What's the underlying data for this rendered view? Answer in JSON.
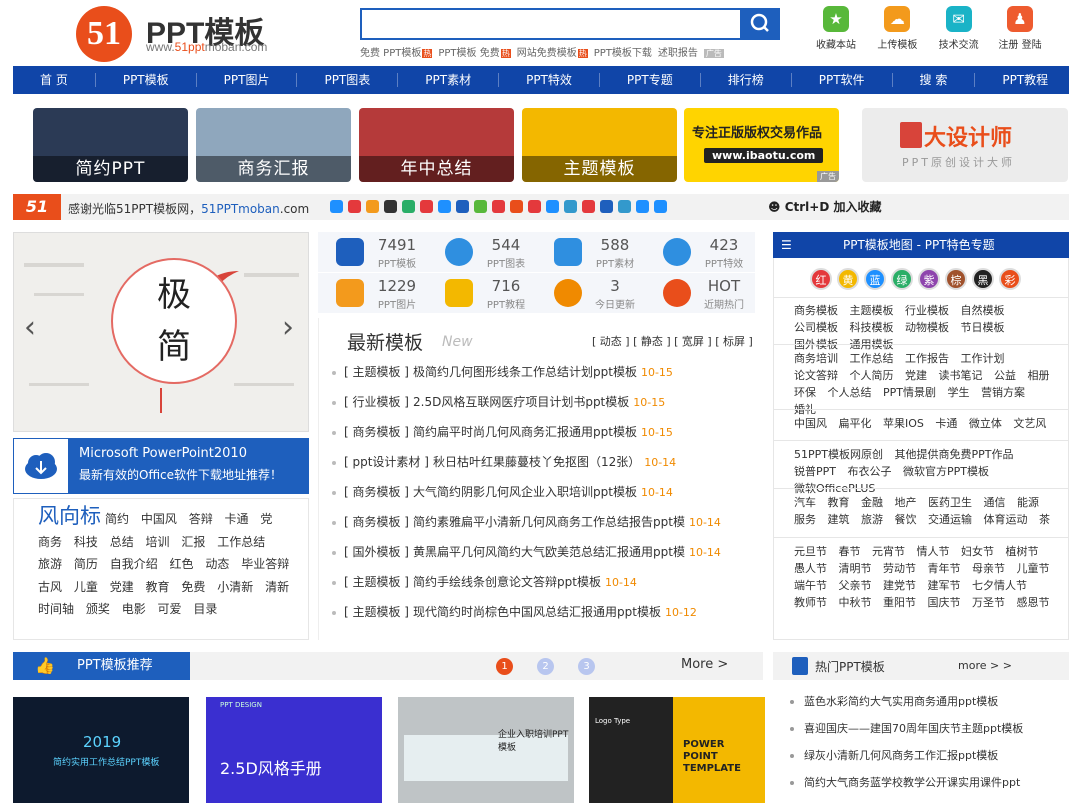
{
  "header": {
    "logo_mark": "51",
    "logo_title": "PPT模板",
    "logo_url_prefix": "www.",
    "logo_url_brand": "51ppt",
    "logo_url_suffix": "moban.com",
    "search_placeholder": "",
    "hot_links": [
      {
        "text": "免费 PPT模板",
        "badge": "热"
      },
      {
        "text": "PPT模板 免费",
        "badge": "热"
      },
      {
        "text": "网站免费模板",
        "badge": "热"
      },
      {
        "text": "PPT模板下载",
        "badge": ""
      },
      {
        "text": "述职报告",
        "badge": ""
      }
    ],
    "ad_label": "广告",
    "quick_links": [
      {
        "label": "收藏本站",
        "icon": "star-icon",
        "glyph": "★",
        "color": "#58b83a"
      },
      {
        "label": "上传模板",
        "icon": "upload-cloud-icon",
        "glyph": "☁",
        "color": "#f39a1c"
      },
      {
        "label": "技术交流",
        "icon": "chat-icon",
        "glyph": "✉",
        "color": "#1ab3c7"
      },
      {
        "label": "注册 登陆",
        "icon": "user-icon",
        "glyph": "♟",
        "color": "#ee5b2f"
      }
    ]
  },
  "nav": [
    "首 页",
    "PPT模板",
    "PPT图片",
    "PPT图表",
    "PPT素材",
    "PPT特效",
    "PPT专题",
    "排行榜",
    "PPT软件",
    "搜 索",
    "PPT教程"
  ],
  "banners": [
    {
      "caption": "简约PPT",
      "color": "#2b3a55"
    },
    {
      "caption": "商务汇报",
      "color": "#8fa7bd"
    },
    {
      "caption": "年中总结",
      "color": "#b53a3a"
    },
    {
      "caption": "主题模板",
      "color": "#f3b800"
    },
    {
      "caption": "",
      "color": "#ffd400",
      "line1": "专注正版版权交易作品",
      "line2": "www.ibaotu.com",
      "ad": "广告"
    },
    {
      "caption": "",
      "color": "#ececec",
      "line1": "大设计师",
      "line2": "PPT原创设计大师"
    }
  ],
  "welcome": {
    "logo": "51",
    "text_prefix": "感谢光临51PPT模板网，",
    "text_brand": "51PPTmoban",
    "text_suffix": ".com",
    "shortcut": "Ctrl+D 加入收藏",
    "social_colors": [
      "#1e90ff",
      "#e4393c",
      "#f39a1c",
      "#333333",
      "#2aae67",
      "#e4393c",
      "#1e90ff",
      "#1e5fbd",
      "#58b83a",
      "#e4393c",
      "#e94e1b",
      "#e4393c",
      "#1e90ff",
      "#3399cc",
      "#e4393c",
      "#1e5fbd",
      "#3399cc",
      "#1e90ff",
      "#1e90ff"
    ]
  },
  "slide": {
    "char1": "极",
    "char2": "简",
    "prev": "‹",
    "next": "›"
  },
  "office": {
    "title": "Microsoft PowerPoint2010",
    "subtitle": "最新有效的Office软件下载地址推荐！"
  },
  "tags": {
    "heading": "风向标",
    "items": [
      "简约",
      "中国风",
      "答辩",
      "卡通",
      "党",
      "商务",
      "科技",
      "总结",
      "培训",
      "汇报",
      "工作总结",
      "旅游",
      "简历",
      "自我介绍",
      "红色",
      "动态",
      "毕业答辩",
      "古风",
      "儿童",
      "党建",
      "教育",
      "免费",
      "小清新",
      "清新",
      "时间轴",
      "颁奖",
      "电影",
      "可爱",
      "目录"
    ]
  },
  "stats": [
    {
      "num": "7491",
      "label": "PPT模板",
      "icon": "ppt-icon",
      "color": "#1e5fbd"
    },
    {
      "num": "544",
      "label": "PPT图表",
      "icon": "pie-chart-icon",
      "color": "#2f8fe0"
    },
    {
      "num": "588",
      "label": "PPT素材",
      "icon": "link-icon",
      "color": "#2f8fe0"
    },
    {
      "num": "423",
      "label": "PPT特效",
      "icon": "spinner-icon",
      "color": "#2f8fe0"
    },
    {
      "num": "1229",
      "label": "PPT图片",
      "icon": "image-icon",
      "color": "#f39a1c"
    },
    {
      "num": "716",
      "label": "PPT教程",
      "icon": "book-icon",
      "color": "#f3b800"
    },
    {
      "num": "3",
      "label": "今日更新",
      "icon": "refresh-icon",
      "color": "#f08a00"
    },
    {
      "num": "HOT",
      "label": "近期热门",
      "icon": "hot-icon",
      "color": "#e94e1b"
    }
  ],
  "latest": {
    "title": "最新模板",
    "new_label": "New",
    "filters": "[ 动态 ] [ 静态 ] [ 宽屏 ] [ 标屏 ]",
    "items": [
      {
        "cat": "[ 主题模板 ]",
        "title": "极简约几何图形线条工作总结计划ppt模板",
        "date": "10-15"
      },
      {
        "cat": "[ 行业模板 ]",
        "title": "2.5D风格互联网医疗项目计划书ppt模板",
        "date": "10-15"
      },
      {
        "cat": "[ 商务模板 ]",
        "title": "简约扁平时尚几何风商务汇报通用ppt模板",
        "date": "10-15"
      },
      {
        "cat": "[ ppt设计素材 ]",
        "title": "秋日枯叶红果藤蔓枝丫免抠图（12张）",
        "date": "10-14"
      },
      {
        "cat": "[ 商务模板 ]",
        "title": "大气简约阴影几何风企业入职培训ppt模板",
        "date": "10-14"
      },
      {
        "cat": "[ 商务模板 ]",
        "title": "简约素雅扁平小清新几何风商务工作总结报告ppt模",
        "date": "10-14"
      },
      {
        "cat": "[ 国外模板 ]",
        "title": "黄黑扁平几何风简约大气欧美范总结汇报通用ppt模",
        "date": "10-14"
      },
      {
        "cat": "[ 主题模板 ]",
        "title": "简约手绘线条创意论文答辩ppt模板",
        "date": "10-14"
      },
      {
        "cat": "[ 主题模板 ]",
        "title": "现代简约时尚棕色中国风总结汇报通用ppt模板",
        "date": "10-12"
      }
    ]
  },
  "map": {
    "title": "PPT模板地图 - PPT特色专题",
    "colors": [
      {
        "label": "红",
        "color": "#e4393c"
      },
      {
        "label": "黄",
        "color": "#f3b800"
      },
      {
        "label": "蓝",
        "color": "#1e90ff"
      },
      {
        "label": "绿",
        "color": "#2aae67"
      },
      {
        "label": "紫",
        "color": "#8e44ad"
      },
      {
        "label": "棕",
        "color": "#a0522d"
      },
      {
        "label": "黑",
        "color": "#222222"
      },
      {
        "label": "彩",
        "color": "#e94e1b"
      }
    ],
    "blocks": [
      [
        "商务模板",
        "主题模板",
        "行业模板",
        "自然模板",
        "公司模板",
        "科技模板",
        "动物模板",
        "节日模板",
        "国外模板",
        "通用模板"
      ],
      [
        "商务培训",
        "工作总结",
        "工作报告",
        "工作计划",
        "论文答辩",
        "个人简历",
        "党建",
        "读书笔记",
        "公益",
        "相册",
        "环保",
        "个人总结",
        "PPT情景剧",
        "学生",
        "营销方案",
        "婚礼"
      ],
      [
        "中国风",
        "扁平化",
        "苹果IOS",
        "卡通",
        "微立体",
        "文艺风"
      ],
      [
        "51PPT模板网原创",
        "其他提供商免费PPT作品",
        "锐普PPT",
        "布衣公子",
        "微软官方PPT模板",
        "微软OfficePLUS"
      ],
      [
        "汽车",
        "教育",
        "金融",
        "地产",
        "医药卫生",
        "通信",
        "能源",
        "服务",
        "建筑",
        "旅游",
        "餐饮",
        "交通运输",
        "体育运动",
        "茶"
      ],
      [
        "元旦节",
        "春节",
        "元宵节",
        "情人节",
        "妇女节",
        "植树节",
        "愚人节",
        "清明节",
        "劳动节",
        "青年节",
        "母亲节",
        "儿童节",
        "端午节",
        "父亲节",
        "建党节",
        "建军节",
        "七夕情人节",
        "教师节",
        "中秋节",
        "重阳节",
        "国庆节",
        "万圣节",
        "感恩节"
      ]
    ]
  },
  "recommend": {
    "title": "PPT模板推荐",
    "pages": [
      "1",
      "2",
      "3"
    ],
    "more": "More >",
    "thumbs": [
      {
        "color": "#0d1a2e",
        "text": "2019",
        "sub": "简约实用工作总结PPT模板"
      },
      {
        "color": "#3a2fd0",
        "text": "2.5D风格手册",
        "sub": "PPT DESIGN"
      },
      {
        "color": "#bfc4c6",
        "text": "企业入职培训PPT模板",
        "sub": ""
      },
      {
        "color": "#f3b800",
        "text": "POWER POINT TEMPLATE",
        "sub": "Logo Type"
      }
    ]
  },
  "hot": {
    "title": "热门PPT模板",
    "more": "more > >",
    "items": [
      "蓝色水彩简约大气实用商务通用ppt模板",
      "喜迎国庆——建国70周年国庆节主题ppt模板",
      "绿灰小清新几何风商务工作汇报ppt模板",
      "简约大气商务蓝学校教学公开课实用课件ppt"
    ]
  }
}
